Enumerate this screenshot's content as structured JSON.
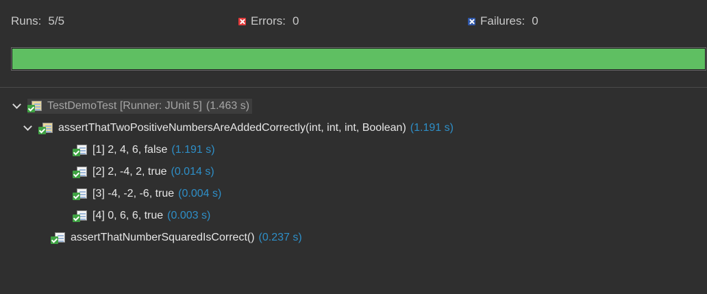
{
  "stats": {
    "runs_label": "Runs:",
    "runs_value": "5/5",
    "errors_label": "Errors:",
    "errors_value": "0",
    "failures_label": "Failures:",
    "failures_value": "0",
    "errors_icon": "error-x-icon",
    "failures_icon": "failure-x-icon"
  },
  "progress": {
    "fraction": 1.0,
    "color": "#5fbf62"
  },
  "colors": {
    "background": "#2f2f2f",
    "time": "#2e8fc8",
    "error_badge": "#e03a3a",
    "failure_badge": "#2f57a8",
    "passed": "#3fa243"
  },
  "tree": {
    "root": {
      "name": "TestDemoTest [Runner: JUnit 5]",
      "time": "(1.463 s)",
      "icon": "test-suite-passed-icon"
    },
    "method1": {
      "name": "assertThatTwoPositiveNumbersAreAddedCorrectly(int, int, int, Boolean)",
      "time": "(1.191 s)",
      "icon": "test-suite-passed-icon"
    },
    "invocations": [
      {
        "name": "[1] 2, 4, 6, false",
        "time": "(1.191 s)",
        "icon": "test-passed-icon"
      },
      {
        "name": "[2] 2, -4, 2, true",
        "time": "(0.014 s)",
        "icon": "test-passed-icon"
      },
      {
        "name": "[3] -4, -2, -6, true",
        "time": "(0.004 s)",
        "icon": "test-passed-icon"
      },
      {
        "name": "[4] 0, 6, 6, true",
        "time": "(0.003 s)",
        "icon": "test-passed-icon"
      }
    ],
    "method2": {
      "name": "assertThatNumberSquaredIsCorrect()",
      "time": "(0.237 s)",
      "icon": "test-passed-icon"
    }
  }
}
